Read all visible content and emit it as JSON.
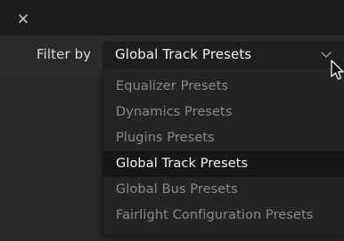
{
  "window": {
    "close_glyph": "close-icon"
  },
  "filter": {
    "label": "Filter by",
    "selected_value": "Global Track Presets",
    "options": [
      "Equalizer Presets",
      "Dynamics Presets",
      "Plugins Presets",
      "Global Track Presets",
      "Global Bus Presets",
      "Fairlight Configuration Presets"
    ],
    "selected_index": 3
  },
  "colors": {
    "background": "#28282a",
    "title_bar": "#1c1c1e",
    "dropdown": "#242426",
    "selected_row": "#161618",
    "text_active": "#f2f2f2",
    "text_muted": "#8a8a8d"
  }
}
